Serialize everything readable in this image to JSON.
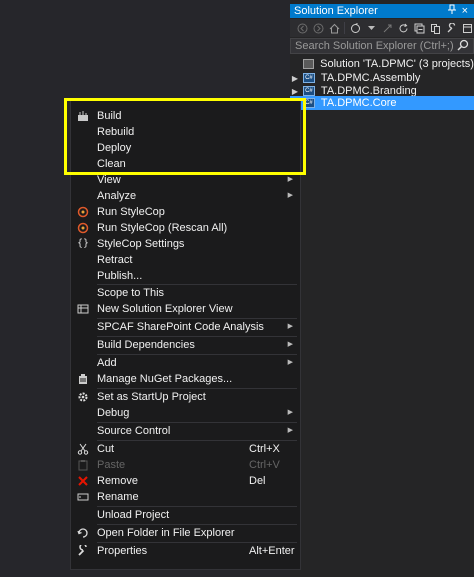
{
  "solution_explorer": {
    "title": "Solution Explorer",
    "pin_icon": "pin-icon",
    "close_glyph": "×",
    "search_placeholder": "Search Solution Explorer (Ctrl+;)",
    "search_icon": "search-icon",
    "tree": [
      {
        "label": "Solution 'TA.DPMC' (3 projects)",
        "kind": "solution"
      },
      {
        "label": "TA.DPMC.Assembly",
        "kind": "project"
      },
      {
        "label": "TA.DPMC.Branding",
        "kind": "project"
      },
      {
        "label": "TA.DPMC.Core",
        "kind": "project",
        "selected": true
      }
    ]
  },
  "context_menu": {
    "items": [
      {
        "label": "Build",
        "icon": "build-icon"
      },
      {
        "label": "Rebuild"
      },
      {
        "label": "Deploy"
      },
      {
        "label": "Clean"
      },
      {
        "label": "View",
        "submenu": true
      },
      {
        "label": "Analyze",
        "submenu": true
      },
      {
        "label": "Run StyleCop",
        "icon": "stylecop-icon"
      },
      {
        "label": "Run StyleCop (Rescan All)",
        "icon": "stylecop-icon"
      },
      {
        "label": "StyleCop Settings",
        "icon": "settings-braces-icon"
      },
      {
        "label": "Retract"
      },
      {
        "label": "Publish..."
      },
      {
        "label": "Scope to This"
      },
      {
        "label": "New Solution Explorer View",
        "icon": "new-view-icon"
      },
      {
        "label": "SPCAF SharePoint Code Analysis",
        "submenu": true
      },
      {
        "label": "Build Dependencies",
        "submenu": true
      },
      {
        "label": "Add",
        "submenu": true
      },
      {
        "label": "Manage NuGet Packages...",
        "icon": "nuget-icon"
      },
      {
        "label": "Set as StartUp Project",
        "icon": "gear-icon"
      },
      {
        "label": "Debug",
        "submenu": true
      },
      {
        "label": "Source Control",
        "submenu": true
      },
      {
        "label": "Cut",
        "shortcut": "Ctrl+X",
        "icon": "scissors-icon"
      },
      {
        "label": "Paste",
        "shortcut": "Ctrl+V",
        "disabled": true,
        "icon": "paste-icon"
      },
      {
        "label": "Remove",
        "shortcut": "Del",
        "icon": "remove-x-icon"
      },
      {
        "label": "Rename",
        "icon": "rename-icon"
      },
      {
        "label": "Unload Project"
      },
      {
        "label": "Open Folder in File Explorer",
        "icon": "open-folder-icon"
      },
      {
        "label": "Properties",
        "shortcut": "Alt+Enter",
        "icon": "wrench-icon"
      }
    ]
  },
  "colors": {
    "highlight_box": "#ffff00",
    "selection": "#3399ff",
    "title_bar": "#007acc"
  }
}
